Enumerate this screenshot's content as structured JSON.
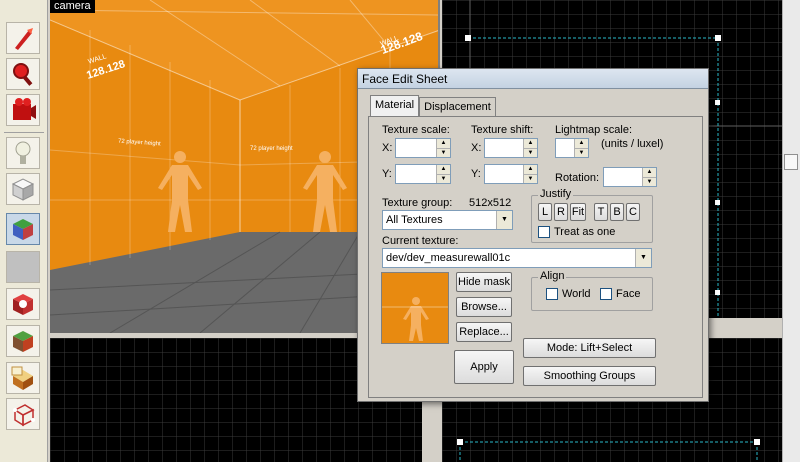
{
  "toolbar": {
    "tools": [
      {
        "name": "selection-tool-icon"
      },
      {
        "name": "magnify-tool-icon"
      },
      {
        "name": "camera-tool-icon"
      },
      {
        "name": "entity-tool-icon"
      },
      {
        "name": "block-tool-icon"
      },
      {
        "name": "texture-application-tool-icon"
      },
      {
        "name": "apply-decal-tool-icon"
      },
      {
        "name": "overlay-tool-icon"
      },
      {
        "name": "clipping-tool-icon"
      },
      {
        "name": "vertex-manipulation-tool-icon"
      },
      {
        "name": "path-tool-icon"
      }
    ]
  },
  "camera": {
    "label": "camera",
    "wall_texts": [
      "WALL",
      "128.128",
      "WALL",
      "128.128",
      "72 player height",
      "72 player height"
    ]
  },
  "dialog": {
    "title": "Face Edit Sheet",
    "tabs": [
      "Material",
      "Displacement"
    ],
    "texture_scale": {
      "label": "Texture scale:",
      "x_label": "X:",
      "y_label": "Y:",
      "x_value": "",
      "y_value": ""
    },
    "texture_shift": {
      "label": "Texture shift:",
      "x_label": "X:",
      "y_label": "Y:",
      "x_value": "",
      "y_value": ""
    },
    "lightmap": {
      "label": "Lightmap scale:",
      "units": "(units / luxel)",
      "value": ""
    },
    "rotation": {
      "label": "Rotation:",
      "value": ""
    },
    "texture_group": {
      "label": "Texture group:",
      "size": "512x512",
      "selected": "All Textures"
    },
    "justify": {
      "title": "Justify",
      "buttons": [
        "L",
        "R",
        "Fit",
        "T",
        "B",
        "C"
      ],
      "treat_as_one": "Treat as one"
    },
    "current_texture": {
      "label": "Current texture:",
      "value": "dev/dev_measurewall01c"
    },
    "buttons": {
      "hide_mask": "Hide mask",
      "browse": "Browse...",
      "replace": "Replace...",
      "apply": "Apply",
      "mode": "Mode: Lift+Select",
      "smoothing": "Smoothing Groups"
    },
    "align": {
      "title": "Align",
      "world": "World",
      "face": "Face"
    }
  },
  "colors": {
    "accent": "#e88a10",
    "grid_bg": "#000000",
    "grid_line": "#3a3a3a",
    "grid_cyan": "#2ab8c8"
  }
}
